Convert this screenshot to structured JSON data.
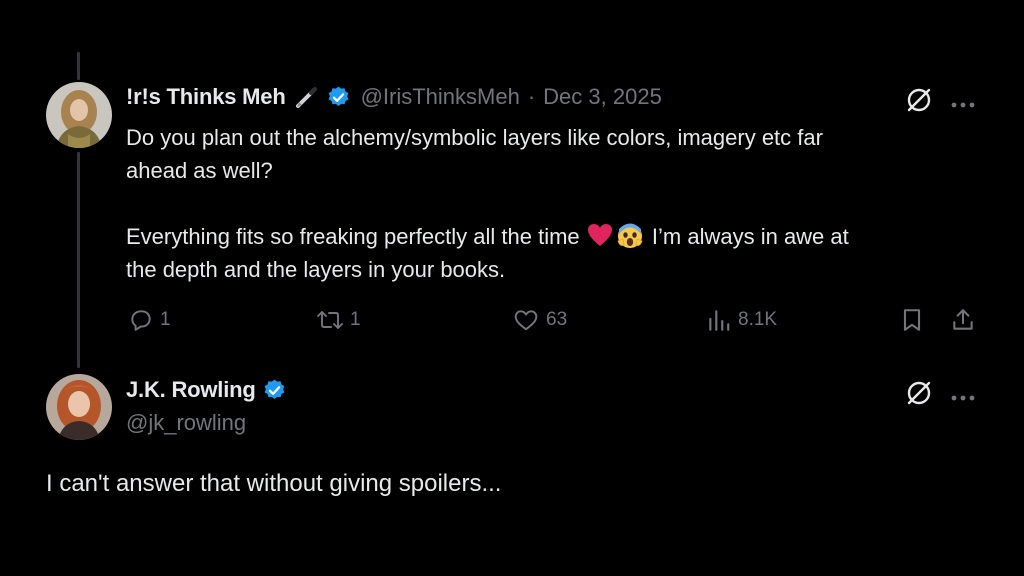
{
  "original_tweet": {
    "display_name": "!r!s Thinks Meh",
    "handle": "@IrisThinksMeh",
    "separator": "·",
    "date": "Dec 3, 2025",
    "text_lines": [
      "Do you plan out the alchemy/symbolic layers like colors, imagery etc far",
      "ahead as well?",
      "Everything fits so freaking perfectly all the time",
      "I’m always in awe at",
      "the depth and the layers in your books."
    ],
    "actions": {
      "replies": "1",
      "reposts": "1",
      "likes": "63",
      "views": "8.1K"
    },
    "icons": [
      "pen-emoji-icon",
      "verified-badge-icon",
      "grok-icon",
      "more-icon",
      "reply-icon",
      "repost-icon",
      "like-icon",
      "views-icon",
      "bookmark-icon",
      "share-icon",
      "red-heart-emoji",
      "screaming-face-emoji"
    ]
  },
  "reply_tweet": {
    "display_name": "J.K. Rowling",
    "handle": "@jk_rowling",
    "text": "I can't answer that without giving spoilers...",
    "icons": [
      "verified-badge-icon",
      "grok-icon",
      "more-icon"
    ]
  },
  "colors": {
    "background": "#000000",
    "text": "#e7e9ea",
    "secondary": "#71767b",
    "verified_blue": "#1d9bf0",
    "thread_line": "#333639"
  }
}
